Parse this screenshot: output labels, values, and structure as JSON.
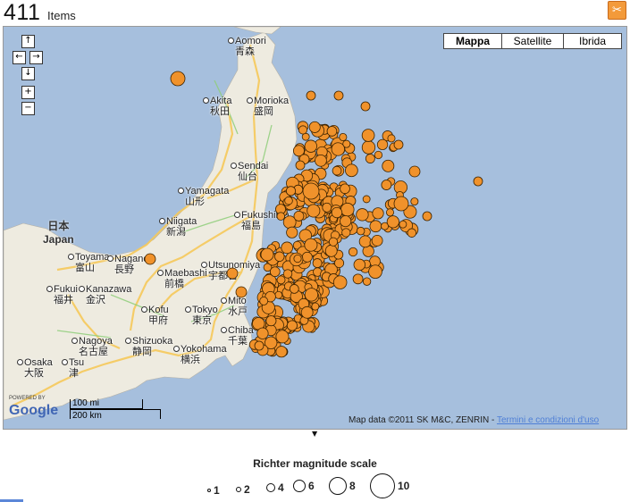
{
  "header": {
    "count": "411",
    "count_label": "Items",
    "tool_icon": "scissors-icon"
  },
  "map": {
    "types": [
      {
        "label": "Mappa",
        "active": true
      },
      {
        "label": "Satellite",
        "active": false
      },
      {
        "label": "Ibrida",
        "active": false
      }
    ],
    "nav_buttons": [
      "↑",
      "←",
      "→",
      "↓",
      "+",
      "−"
    ],
    "country": {
      "name_jp": "日本",
      "name_en": "Japan"
    },
    "cities": [
      {
        "en": "Aomori",
        "jp": "青森"
      },
      {
        "en": "Akita",
        "jp": "秋田"
      },
      {
        "en": "Morioka",
        "jp": "盛岡"
      },
      {
        "en": "Sendai",
        "jp": "仙台"
      },
      {
        "en": "Yamagata",
        "jp": "山形"
      },
      {
        "en": "Niigata",
        "jp": "新潟"
      },
      {
        "en": "Fukushima",
        "jp": "福島"
      },
      {
        "en": "Toyama",
        "jp": "富山"
      },
      {
        "en": "Nagano",
        "jp": "長野"
      },
      {
        "en": "Maebashi",
        "jp": "前橋"
      },
      {
        "en": "Utsunomiya",
        "jp": "宇都宮"
      },
      {
        "en": "Fukui",
        "jp": "福井"
      },
      {
        "en": "Kanazawa",
        "jp": "金沢"
      },
      {
        "en": "Kofu",
        "jp": "甲府"
      },
      {
        "en": "Tokyo",
        "jp": "東京"
      },
      {
        "en": "Mito",
        "jp": "水戸"
      },
      {
        "en": "Chiba",
        "jp": "千葉"
      },
      {
        "en": "Nagoya",
        "jp": "名古屋"
      },
      {
        "en": "Shizuoka",
        "jp": "静岡"
      },
      {
        "en": "Yokohama",
        "jp": "横浜"
      },
      {
        "en": "Osaka",
        "jp": "大阪"
      },
      {
        "en": "Tsu",
        "jp": "津"
      }
    ],
    "scale": {
      "imperial": "100 mi",
      "metric": "200 km"
    },
    "google": {
      "logo": "Google",
      "powered_by": "POWERED BY"
    },
    "copyright": {
      "text": "Map data ©2011 SK M&C, ZENRIN - ",
      "link": "Termini e condizioni d'uso"
    },
    "marker_color": "#f0922b"
  },
  "legend": {
    "title": "Richter magnitude scale",
    "items": [
      {
        "label": "1"
      },
      {
        "label": "2"
      },
      {
        "label": "4"
      },
      {
        "label": "6"
      },
      {
        "label": "8"
      },
      {
        "label": "10"
      }
    ]
  }
}
